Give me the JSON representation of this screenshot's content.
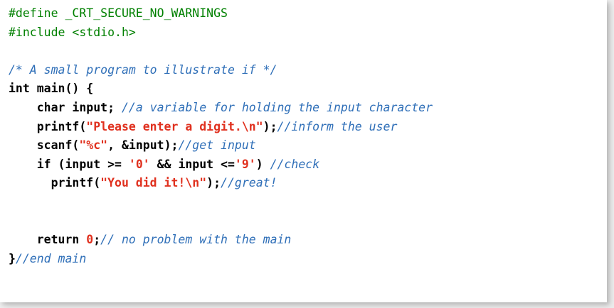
{
  "editor": {
    "lines": [
      {
        "segments": [
          {
            "t": "#define _CRT_SECURE_NO_WARNINGS",
            "k": "pp"
          }
        ]
      },
      {
        "segments": [
          {
            "t": "#include <stdio.h>",
            "k": "pp"
          }
        ]
      },
      {
        "segments": []
      },
      {
        "segments": [
          {
            "t": "/* A small program to illustrate if */",
            "k": "cm"
          }
        ]
      },
      {
        "segments": [
          {
            "t": "int main() {",
            "k": "plain"
          }
        ]
      },
      {
        "segments": [
          {
            "t": "    char input; ",
            "k": "plain"
          },
          {
            "t": "//a variable for holding the input character",
            "k": "cm"
          }
        ]
      },
      {
        "segments": [
          {
            "t": "    printf(",
            "k": "plain"
          },
          {
            "t": "\"Please enter a digit.\\n\"",
            "k": "str"
          },
          {
            "t": ");",
            "k": "plain"
          },
          {
            "t": "//inform the user",
            "k": "cm"
          }
        ]
      },
      {
        "segments": [
          {
            "t": "    scanf(",
            "k": "plain"
          },
          {
            "t": "\"%c\"",
            "k": "str"
          },
          {
            "t": ", &input);",
            "k": "plain"
          },
          {
            "t": "//get input",
            "k": "cm"
          }
        ]
      },
      {
        "segments": [
          {
            "t": "    if (input >= ",
            "k": "plain"
          },
          {
            "t": "'0'",
            "k": "str"
          },
          {
            "t": " && input <=",
            "k": "plain"
          },
          {
            "t": "'9'",
            "k": "str"
          },
          {
            "t": ") ",
            "k": "plain"
          },
          {
            "t": "//check",
            "k": "cm"
          }
        ]
      },
      {
        "segments": [
          {
            "t": "      printf(",
            "k": "plain"
          },
          {
            "t": "\"You did it!\\n\"",
            "k": "str"
          },
          {
            "t": ");",
            "k": "plain"
          },
          {
            "t": "//great!",
            "k": "cm"
          }
        ]
      },
      {
        "segments": []
      },
      {
        "segments": []
      },
      {
        "segments": [
          {
            "t": "    return ",
            "k": "plain"
          },
          {
            "t": "0",
            "k": "num"
          },
          {
            "t": ";",
            "k": "plain"
          },
          {
            "t": "// no problem with the main",
            "k": "cm"
          }
        ]
      },
      {
        "segments": [
          {
            "t": "}",
            "k": "plain"
          },
          {
            "t": "//end main",
            "k": "cm"
          }
        ]
      }
    ]
  },
  "colors": {
    "preprocessor": "#008000",
    "comment": "#2f6fb8",
    "string": "#e0301e",
    "plain": "#000000",
    "background": "#ffffff"
  }
}
